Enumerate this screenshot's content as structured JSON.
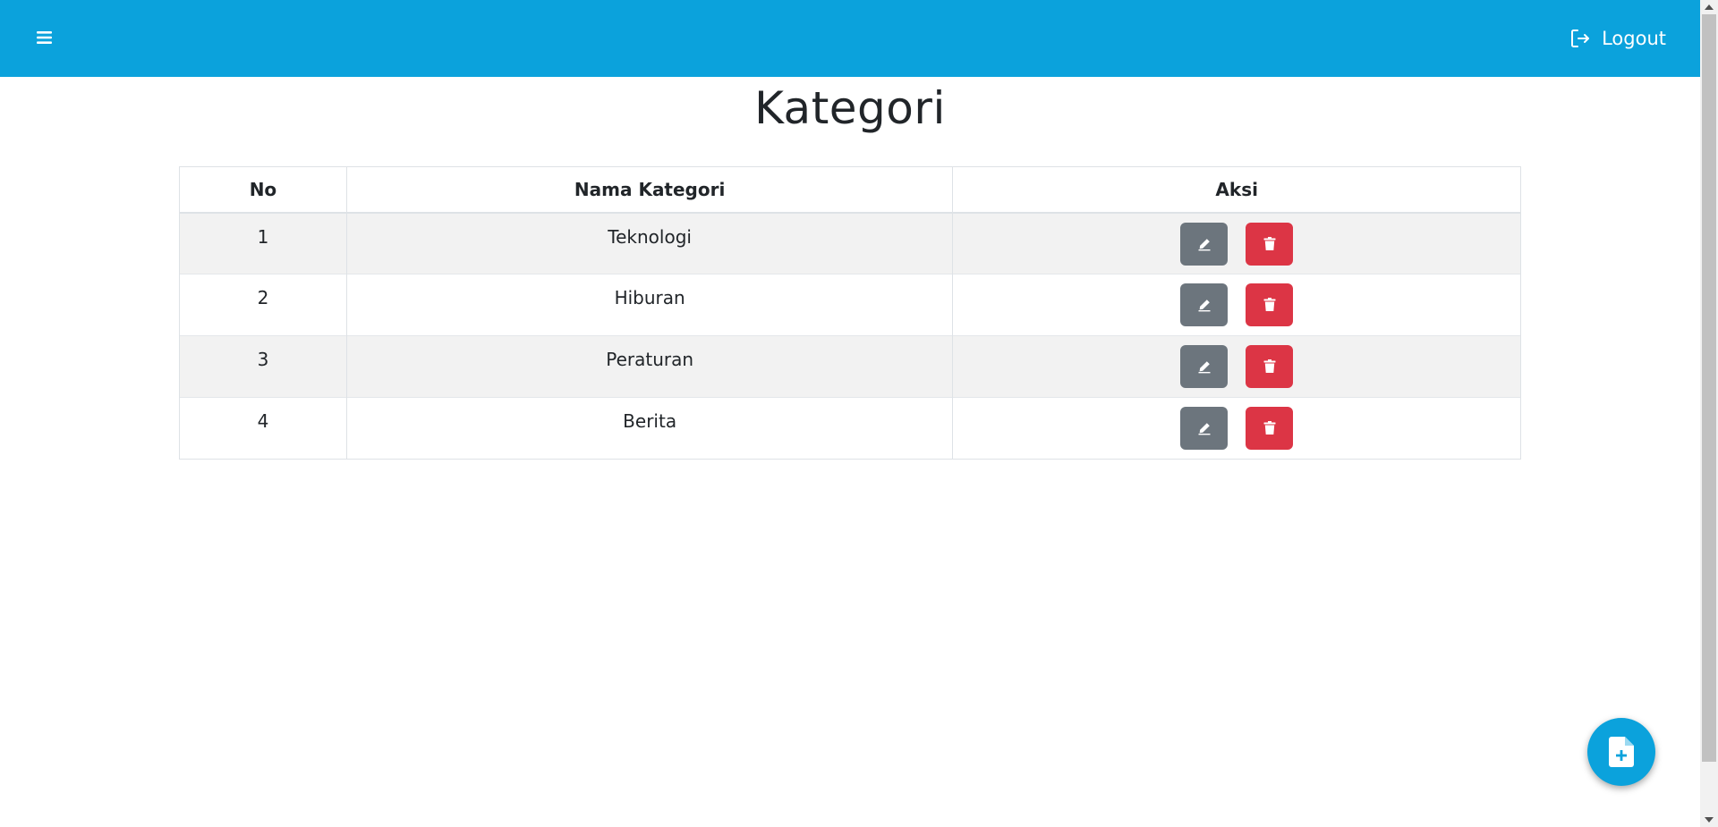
{
  "header": {
    "menu_icon": "hamburger-icon",
    "logout_label": "Logout",
    "logout_icon": "logout-icon",
    "brand_color": "#0ba2dc"
  },
  "page": {
    "title": "Kategori"
  },
  "table": {
    "columns": [
      "No",
      "Nama Kategori",
      "Aksi"
    ],
    "rows": [
      {
        "no": "1",
        "name": "Teknologi"
      },
      {
        "no": "2",
        "name": "Hiburan"
      },
      {
        "no": "3",
        "name": "Peraturan"
      },
      {
        "no": "4",
        "name": "Berita"
      }
    ],
    "edit_icon": "pencil-icon",
    "delete_icon": "trash-icon",
    "edit_color": "#6c757d",
    "delete_color": "#dc3545"
  },
  "fab": {
    "icon": "add-file-icon"
  }
}
